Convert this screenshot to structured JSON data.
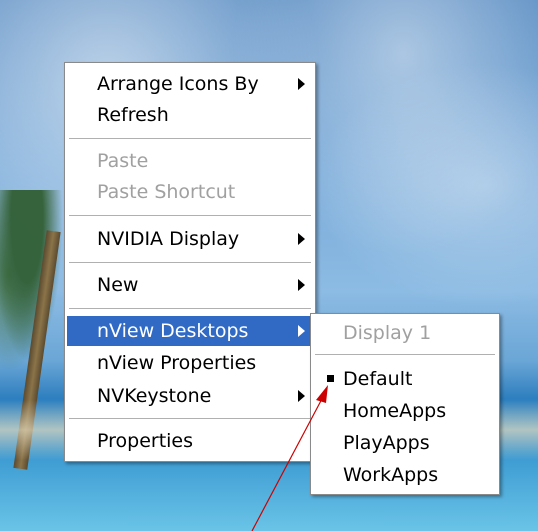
{
  "context_menu": {
    "items": [
      {
        "label": "Arrange Icons By"
      },
      {
        "label": "Refresh"
      },
      {
        "label": "Paste"
      },
      {
        "label": "Paste Shortcut"
      },
      {
        "label": "NVIDIA Display"
      },
      {
        "label": "New"
      },
      {
        "label": "nView Desktops"
      },
      {
        "label": "nView Properties"
      },
      {
        "label": "NVKeystone"
      },
      {
        "label": "Properties"
      }
    ]
  },
  "submenu": {
    "header": "Display 1",
    "items": [
      {
        "label": "Default"
      },
      {
        "label": "HomeApps"
      },
      {
        "label": "PlayApps"
      },
      {
        "label": "WorkApps"
      }
    ]
  },
  "colors": {
    "highlight": "#316ac5",
    "annotation_arrow": "#cc0000"
  }
}
